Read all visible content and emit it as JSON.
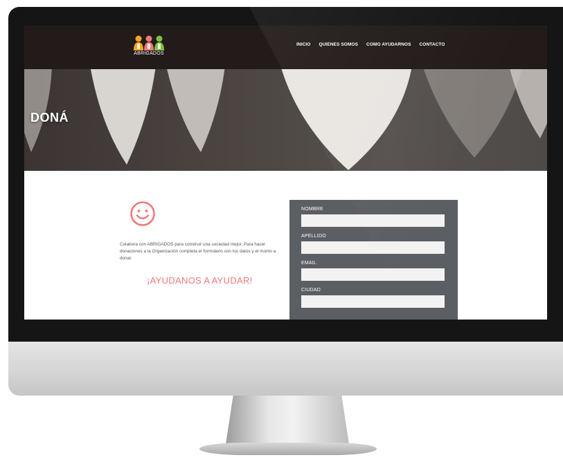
{
  "site": {
    "logo_text": "ABRIGADOS",
    "nav": [
      {
        "label": "INICIO"
      },
      {
        "label": "QUIENES SOMOS"
      },
      {
        "label": "COMO AYUDARNOS"
      },
      {
        "label": "CONTACTO"
      }
    ]
  },
  "hero": {
    "title": "DONÁ"
  },
  "content": {
    "intro": "Colabora con ABRIGADOS para construir una sociedad mejor. Para hacer donaciones a la Organización completa el formulario con tus datos y el monto a donar.",
    "cta": "¡AYUDANOS A AYUDAR!"
  },
  "form": {
    "fields": [
      {
        "label": "NOMBRE",
        "value": ""
      },
      {
        "label": "APELLIDO",
        "value": ""
      },
      {
        "label": "EMAIL",
        "value": ""
      },
      {
        "label": "CIUDAD",
        "value": ""
      },
      {
        "label": "",
        "value": ""
      }
    ]
  },
  "colors": {
    "nav_bg": "#231b1a",
    "accent": "#f07878",
    "form_bg": "#5b5e63",
    "input_bg": "#f2f2f2",
    "logo_orange": "#f5a623",
    "logo_pink": "#f07878",
    "logo_green": "#7cc242"
  },
  "icons": [
    "smiley-icon",
    "logo-figures-icon"
  ]
}
